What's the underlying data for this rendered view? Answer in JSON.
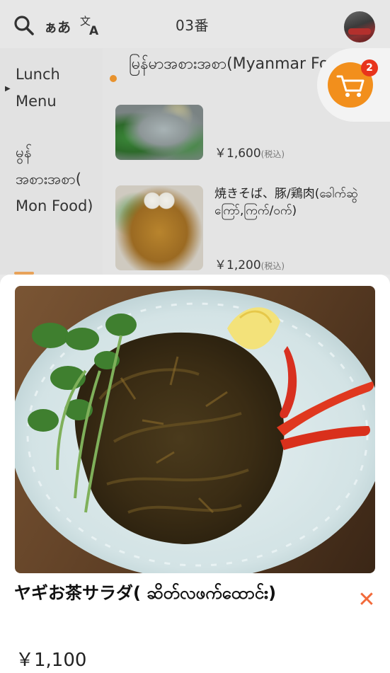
{
  "header": {
    "kana_label": "ぁあ",
    "table_label": "03番"
  },
  "sidebar": {
    "categories": [
      {
        "label": "Lunch Menu",
        "selected": true
      },
      {
        "label": "မွန် အစားအစာ( Mon Food)",
        "selected": false
      }
    ]
  },
  "main": {
    "section_title": "မြန်မာအစားအစာ(Myanmar Food)",
    "items": [
      {
        "name": "",
        "price": "￥1,600",
        "tax_label": "(税込)"
      },
      {
        "name": "焼きそば、豚/鶏肉(ခေါက်ဆွဲကြော်,ကြက်/ဝက်)",
        "price": "￥1,200",
        "tax_label": "(税込)"
      }
    ]
  },
  "cart": {
    "count": "2",
    "accent": "#f28f1c",
    "badge_color": "#e8341c"
  },
  "detail": {
    "name": "ヤギお茶サラダ( ဆိတ်လဖက်ထောင်း)",
    "price": "￥1,100",
    "close_color": "#f26a3a"
  }
}
